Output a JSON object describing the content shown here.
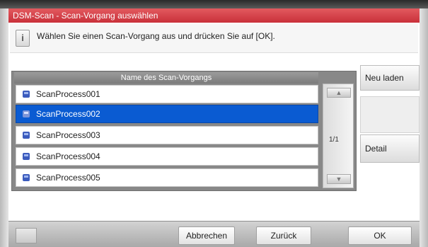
{
  "window": {
    "title": "DSM-Scan - Scan-Vorgang auswählen"
  },
  "message": {
    "icon": "info-icon",
    "text": "Wählen Sie einen Scan-Vorgang aus und drücken Sie auf [OK]."
  },
  "list": {
    "header": "Name des Scan-Vorgangs",
    "items": [
      {
        "label": "ScanProcess001",
        "selected": false
      },
      {
        "label": "ScanProcess002",
        "selected": true
      },
      {
        "label": "ScanProcess003",
        "selected": false
      },
      {
        "label": "ScanProcess004",
        "selected": false
      },
      {
        "label": "ScanProcess005",
        "selected": false
      }
    ],
    "page": "1/1"
  },
  "side": {
    "reload_label": "Neu laden",
    "detail_label": "Detail"
  },
  "footer": {
    "cancel_label": "Abbrechen",
    "back_label": "Zurück",
    "ok_label": "OK"
  },
  "colors": {
    "title_bar": "#d7353f",
    "selection": "#0a5bd2"
  }
}
